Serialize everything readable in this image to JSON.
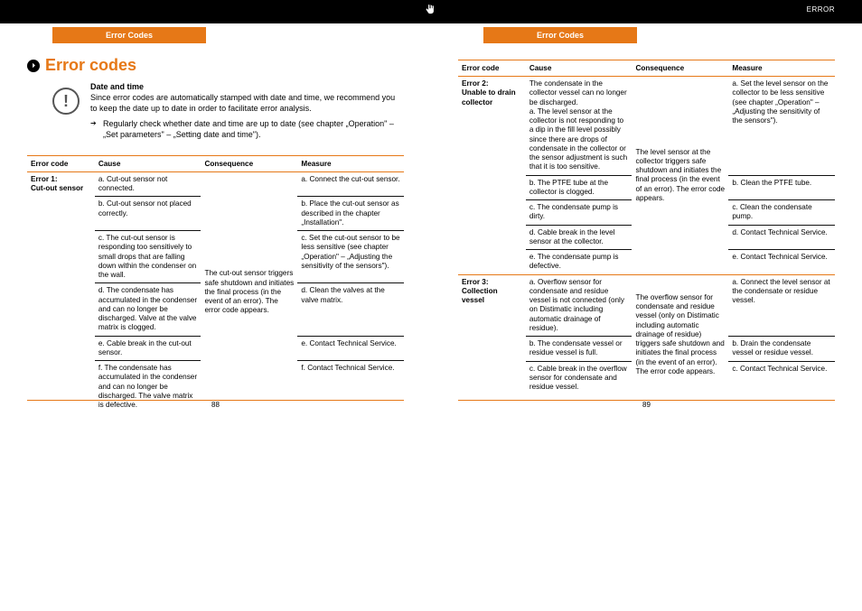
{
  "topbar": {
    "right_label": "ERROR"
  },
  "tabs": {
    "left": "Error Codes",
    "right": "Error Codes"
  },
  "title": "Error codes",
  "note": {
    "heading": "Date and time",
    "body": "Since error codes are automatically stamped with date and time, we recommend you to keep the date up to date in order to facilitate error analysis.",
    "tip": "Regularly check whether date and time are up to date (see chapter „Operation\" – „Set parameters\" – „Setting date and time\")."
  },
  "headers": {
    "code": "Error code",
    "cause": "Cause",
    "consequence": "Consequence",
    "measure": "Measure"
  },
  "left_table": {
    "code": "Error 1:\nCut-out sensor",
    "consequence": "The cut-out sensor triggers safe shutdown and initiates the final process (in the event of an error). The error code appears.",
    "rows": [
      {
        "cause": "a. Cut-out sensor not connected.",
        "measure": "a. Connect the cut-out sensor."
      },
      {
        "cause": "b. Cut-out sensor not placed correctly.",
        "measure": "b. Place the cut-out sensor as described in the chapter „Installation\"."
      },
      {
        "cause": "c. The cut-out sensor is responding too sensitively to small drops that are falling down within the condenser on the wall.",
        "measure": "c. Set the cut-out sensor to be less sensitive (see chapter „Operation\" – „Adjusting the sensitivity of the sensors\")."
      },
      {
        "cause": "d. The condensate has accumulated in the condenser and can no longer be discharged. Valve at the valve matrix is clogged.",
        "measure": "d. Clean the valves at the valve matrix."
      },
      {
        "cause": "e. Cable break in the cut-out sensor.",
        "measure": "e. Contact Technical Service."
      },
      {
        "cause": "f. The condensate has accumulated in the condenser and can no longer be discharged. The valve matrix is defective.",
        "measure": "f. Contact Technical Service."
      }
    ]
  },
  "right_table": {
    "err2": {
      "code": "Error 2:\nUnable to drain collector",
      "intro_cause": "The condensate in the collector vessel can no longer be discharged.",
      "consequence": "The level sensor at the collector triggers safe shutdown and initiates the final process (in the event of an error). The error code appears.",
      "rows": [
        {
          "cause": "a. The level sensor at the collector is not responding to a dip in the fill level possibly since there are drops of condensate in the collector or the sensor adjustment is such that it is too sensitive.",
          "measure": "a. Set the level sensor on the collector to be less sensitive (see chapter „Operation\" – „Adjusting the sensitivity of the sensors\")."
        },
        {
          "cause": "b. The PTFE tube at the collector is clogged.",
          "measure": "b. Clean the PTFE tube."
        },
        {
          "cause": "c. The condensate pump is dirty.",
          "measure": "c. Clean the condensate pump."
        },
        {
          "cause": "d. Cable break in the level  sensor at the collector.",
          "measure": "d. Contact Technical Service."
        },
        {
          "cause": "e. The condensate pump is defective.",
          "measure": "e. Contact Technical Service."
        }
      ]
    },
    "err3": {
      "code": "Error 3:\nCollection vessel",
      "consequence": "The overflow sensor for condensate and residue vessel (only on Distimatic including automatic drainage of residue) triggers safe shutdown and initiates the final process (in the event of an error). The error code appears.",
      "rows": [
        {
          "cause": "a. Overflow sensor for condensate and residue vessel is not connected (only on Distimatic including automatic drainage of residue).",
          "measure": "a. Connect the level sensor  at the condensate or residue vessel."
        },
        {
          "cause": "b. The condensate vessel or residue vessel is full.",
          "measure": "b. Drain the condensate vessel or residue vessel."
        },
        {
          "cause": "c. Cable break in the overflow sensor for condensate and residue vessel.",
          "measure": "c. Contact Technical Service."
        }
      ]
    }
  },
  "pages": {
    "left": "88",
    "right": "89"
  }
}
